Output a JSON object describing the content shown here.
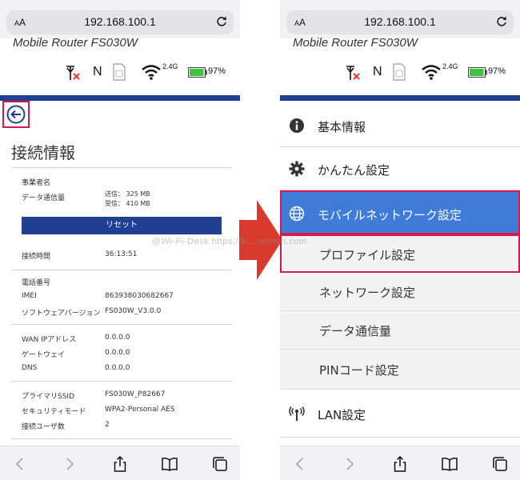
{
  "browser": {
    "aa_label": "AA",
    "url": "192.168.100.1"
  },
  "router": {
    "title": "Mobile Router FS030W",
    "network_type": "N",
    "wifi_band": "2.4G",
    "battery_percent": "97%",
    "battery_level": 0.97
  },
  "left": {
    "heading": "接続情報",
    "section1": {
      "operator_label": "事業者名",
      "data_usage_label": "データ通信量",
      "sent": "送信： 325 MB",
      "received": "受信： 410 MB",
      "reset_label": "リセット",
      "connect_time_label": "接続時間",
      "connect_time_value": "36:13:51"
    },
    "section2": {
      "phone_label": "電話番号",
      "imei_label": "IMEI",
      "imei_value": "863938030682667",
      "sw_label": "ソフトウェアバージョン",
      "sw_value": "FS030W_V3.0.0"
    },
    "section3": {
      "wan_label": "WAN IPアドレス",
      "wan_value": "0.0.0.0",
      "gw_label": "ゲートウェイ",
      "gw_value": "0.0.0.0",
      "dns_label": "DNS",
      "dns_value": "0.0.0.0"
    },
    "section4": {
      "ssid_label": "プライマリSSID",
      "ssid_value": "FS030W_P82667",
      "security_label": "セキュリティモード",
      "security_value": "WPA2-Personal AES",
      "users_label": "接続ユーザ数",
      "users_value": "2"
    }
  },
  "menu": {
    "basic_info": "基本情報",
    "easy_setup": "かんたん設定",
    "mobile_network": "モバイルネットワーク設定",
    "profile": "プロファイル設定",
    "network": "ネットワーク設定",
    "data_usage": "データ通信量",
    "pin_code": "PINコード設定",
    "lan": "LAN設定"
  },
  "watermark": "@Wi-Fi-Desk https://ki...nomori.com",
  "colors": {
    "header_band": "#1f3f93",
    "active_menu": "#3f7bd8",
    "highlight_border": "#d8174b",
    "arrow": "#d93a2b",
    "battery_fill": "#3cc43c"
  }
}
